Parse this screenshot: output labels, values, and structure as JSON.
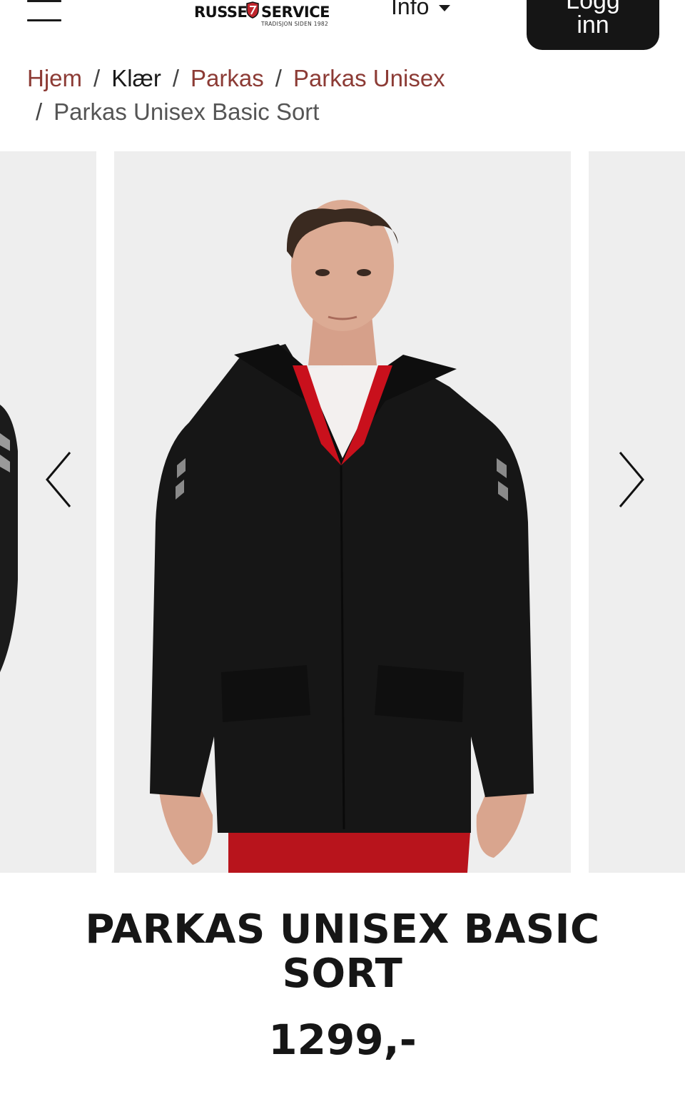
{
  "header": {
    "menu_icon": "hamburger-menu-icon",
    "logo": {
      "word_left": "RUSSE",
      "word_right": "SERVICE",
      "tagline": "TRADISJON SIDEN 1982",
      "shield_color": "#c0262d"
    },
    "info_menu": {
      "label": "Info",
      "icon": "caret-down-icon"
    },
    "login_button": {
      "line1": "Logg",
      "line2": "inn"
    }
  },
  "breadcrumb": {
    "items": [
      {
        "label": "Hjem"
      },
      {
        "label": "Klær"
      },
      {
        "label": "Parkas"
      },
      {
        "label": "Parkas Unisex"
      },
      {
        "label": "Parkas Unisex Basic Sort"
      }
    ],
    "separator": "/"
  },
  "gallery": {
    "prev_icon": "chevron-left-icon",
    "next_icon": "chevron-right-icon",
    "main_image": "product-photo-black-parka-model",
    "background": "#eeeeee"
  },
  "product": {
    "title": "PARKAS UNISEX BASIC SORT",
    "price": "1299,-"
  },
  "colors": {
    "link": "#8c3b35",
    "text": "#1a1a1a",
    "button_bg": "#151515",
    "button_text": "#ffffff"
  }
}
